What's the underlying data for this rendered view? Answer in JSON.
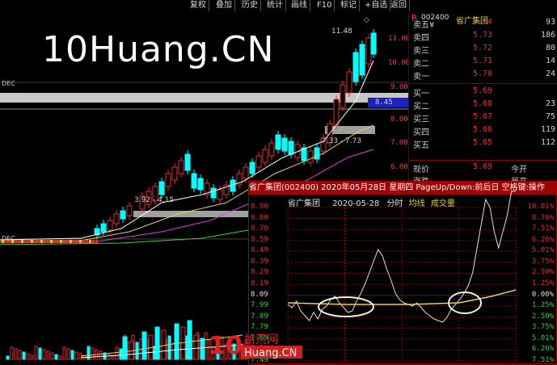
{
  "toolbar": {
    "buttons": [
      "复权",
      "叠加",
      "历史",
      "统计",
      "画线",
      "F10",
      "标记",
      "+自选",
      "返回"
    ]
  },
  "watermark": "10Huang.CN",
  "kchart": {
    "dec_label": "DEC",
    "dec_label2": "DEC",
    "price_ticks": [
      "11.00",
      "10.00",
      "9.00",
      "8.45",
      "8.00",
      "7.00",
      "6.00"
    ],
    "high_label": "11.48",
    "range_label_mid": "7.33 - 7.73",
    "range_label_low": "3.92 - 4.15",
    "band_value": "8.45",
    "marker": "◇"
  },
  "panel": {
    "stock_code": "002400",
    "stock_name": "省广集团",
    "r_icon": "R",
    "asks": [
      {
        "label": "卖五¥",
        "price": "5.74",
        "vol": "93"
      },
      {
        "label": "卖四",
        "price": "5.73",
        "vol": "186"
      },
      {
        "label": "卖三",
        "price": "5.72",
        "vol": "80"
      },
      {
        "label": "卖二",
        "price": "5.71",
        "vol": "14"
      },
      {
        "label": "卖一",
        "price": "5.70",
        "vol": "24"
      }
    ],
    "bids": [
      {
        "label": "买一",
        "price": "5.69",
        "vol": ""
      },
      {
        "label": "买二",
        "price": "5.68",
        "vol": "23"
      },
      {
        "label": "买三",
        "price": "5.67",
        "vol": "75"
      },
      {
        "label": "买四",
        "price": "5.66",
        "vol": "119"
      },
      {
        "label": "买五",
        "price": "5.65",
        "vol": "112"
      }
    ],
    "now_label": "现价",
    "now_price": "5.69",
    "open_label": "今开",
    "chg_label": "涨跌",
    "high_label": "最高"
  },
  "popup": {
    "title": "省广集团(002400) 2020年05月28日 星期四 PageUp/Down:前后日 空格键:操作",
    "name": "省广集团",
    "date": "2020-05-28",
    "kind": "分时",
    "avg_label": "均线",
    "vol_label": "成交量",
    "left_axis": [
      "8.90",
      "8.80",
      "8.70",
      "8.59",
      "8.49",
      "8.39",
      "8.29",
      "8.19",
      "8.09",
      "7.99",
      "7.89",
      "7.79",
      "7.69",
      "7.59",
      "7.49"
    ],
    "right_axis": [
      "10.01%",
      "8.76%",
      "7.51%",
      "6.26%",
      "5.01%",
      "3.75%",
      "2.50%",
      "1.25%",
      "0.00%",
      "1.25%",
      "2.50%",
      "3.75%",
      "5.01%",
      "6.26%",
      "7.51%"
    ]
  },
  "logo": {
    "num": "10",
    "cn": "拾荒网",
    "en": "Huang.CN"
  },
  "colors": {
    "up": "#e03030",
    "down": "#00ffff",
    "ma1": "#ffffff",
    "ma2": "#e8d060",
    "ma3": "#e040e0",
    "ma4": "#40d040",
    "grid": "#8a0000"
  }
}
